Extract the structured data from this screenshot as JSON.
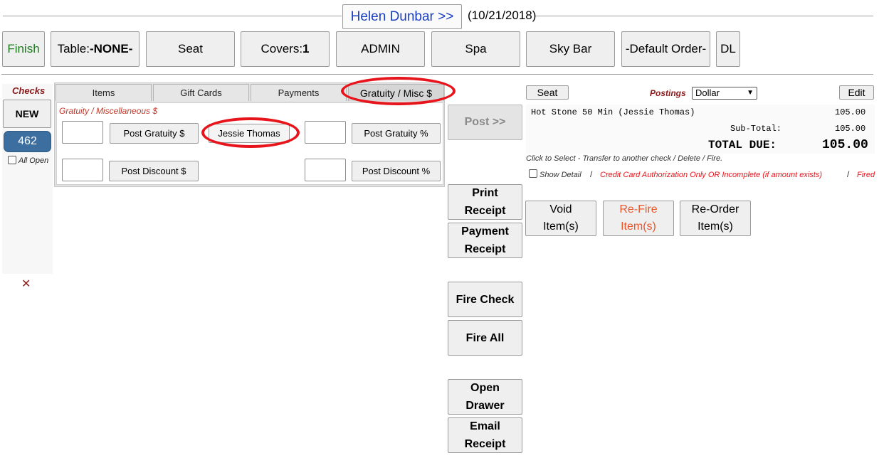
{
  "header": {
    "customer_name": "Helen Dunbar >>",
    "date": "(10/21/2018)"
  },
  "top_buttons": {
    "finish": "Finish",
    "table_label": "Table: ",
    "table_value": "-NONE-",
    "seat": "Seat",
    "covers_label": "Covers: ",
    "covers_value": "1",
    "admin": "ADMIN",
    "spa": "Spa",
    "sky_bar": "Sky Bar",
    "default_order": "-Default Order-",
    "dl": "DL"
  },
  "checks": {
    "title": "Checks",
    "new_button": "NEW",
    "active_check": "462",
    "all_open_label": "All Open",
    "delete_glyph": "✕"
  },
  "tabs": {
    "items": "Items",
    "gift_cards": "Gift Cards",
    "payments": "Payments",
    "gratuity_misc": "Gratuity / Misc $"
  },
  "gratuity_panel": {
    "section_title": "Gratuity / Miscellaneous $",
    "post_gratuity_amount": "Post Gratuity $",
    "staff_name": "Jessie Thomas",
    "post_gratuity_percent": "Post Gratuity %",
    "post_discount_amount": "Post Discount $",
    "post_discount_percent": "Post Discount %",
    "gratuity_amount_value": "",
    "gratuity_percent_value": "",
    "discount_amount_value": "",
    "discount_percent_value": ""
  },
  "middle_buttons": {
    "post": "Post >>",
    "print_receipt_1": "Print",
    "print_receipt_2": "Receipt",
    "payment_receipt_1": "Payment",
    "payment_receipt_2": "Receipt",
    "fire_check": "Fire Check",
    "fire_all": "Fire All",
    "open_drawer_1": "Open",
    "open_drawer_2": "Drawer",
    "email_receipt_1": "Email",
    "email_receipt_2": "Receipt"
  },
  "right_panel": {
    "seat_button": "Seat",
    "postings_label": "Postings",
    "postings_selected": "Dollar",
    "edit_button": "Edit",
    "line_item_name": "Hot Stone 50 Min (Jessie Thomas)",
    "line_item_amount": "105.00",
    "subtotal_label": "Sub-Total:",
    "subtotal_amount": "105.00",
    "total_label": "TOTAL DUE:",
    "total_amount": "105.00",
    "hint": "Click to Select - Transfer to another check / Delete / Fire.",
    "show_detail_label": "Show Detail",
    "sep1": "/",
    "cc_auth_note": "Credit Card Authorization Only OR Incomplete (if amount exists)",
    "sep2": "/",
    "fired_label": "Fired",
    "void_1": "Void",
    "void_2": "Item(s)",
    "refire_1": "Re-Fire",
    "refire_2": "Item(s)",
    "reorder_1": "Re-Order",
    "reorder_2": "Item(s)"
  },
  "colors": {
    "finish_text": "#1e7a1e",
    "customer_link": "#1a3fc4",
    "check_active_bg": "#3c6e9f",
    "accent_red": "#e8141b",
    "label_red": "#8b1a1a",
    "refire_text": "#e8572a"
  }
}
